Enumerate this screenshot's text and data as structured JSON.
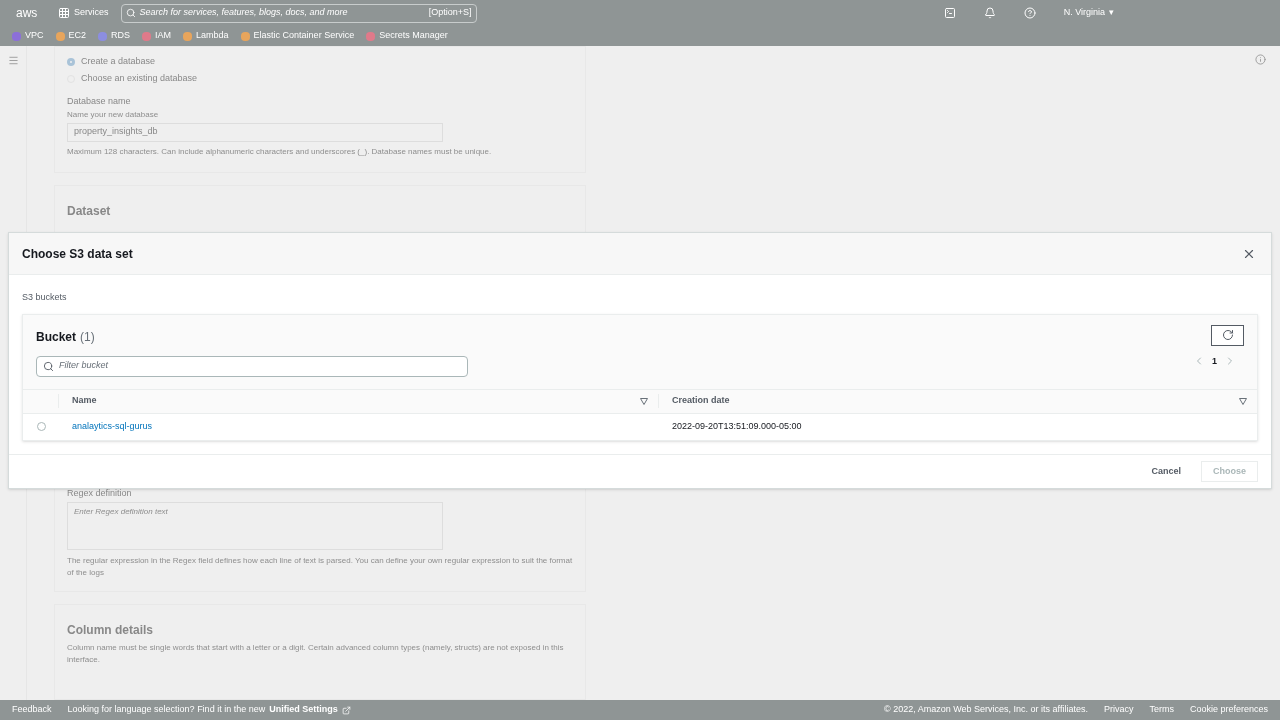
{
  "top_nav": {
    "logo": "aws",
    "services": "Services",
    "region_caret": "▾",
    "search_placeholder": "Search for services, features, blogs, docs, and more",
    "shortcut": "[Option+S]",
    "region": "N. Virginia"
  },
  "favorites": [
    {
      "label": "VPC",
      "color": "#8c6fd8"
    },
    {
      "label": "EC2",
      "color": "#e8a55c"
    },
    {
      "label": "RDS",
      "color": "#8c8ee0"
    },
    {
      "label": "IAM",
      "color": "#e07a8a"
    },
    {
      "label": "Lambda",
      "color": "#e8a55c"
    },
    {
      "label": "Elastic Container Service",
      "color": "#e8a55c"
    },
    {
      "label": "Secrets Manager",
      "color": "#e07a8a"
    }
  ],
  "database": {
    "options": [
      {
        "label": "Create a database",
        "selected": true
      },
      {
        "label": "Choose an existing database",
        "selected": false
      }
    ],
    "name_label": "Database name",
    "name_description": "Name your new database",
    "name_value": "property_insights_db",
    "name_hint": "Maximum 128 characters. Can include alphanumeric characters and underscores (_). Database names must be unique."
  },
  "dataset": {
    "heading": "Dataset",
    "regex_label": "Regex definition",
    "regex_placeholder": "Enter Regex definition text",
    "regex_hint": "The regular expression in the Regex field defines how each line of text is parsed. You can define your own regular expression to suit the format of the logs"
  },
  "column_details": {
    "heading": "Column details",
    "description": "Column name must be single words that start with a letter or a digit. Certain advanced column types (namely, structs) are not exposed in this interface."
  },
  "modal": {
    "title": "Choose S3 data set",
    "section_label": "S3 buckets",
    "table_title": "Bucket",
    "count": "(1)",
    "filter_placeholder": "Filter bucket",
    "page": "1",
    "columns": [
      "Name",
      "Creation date"
    ],
    "rows": [
      {
        "name": "analaytics-sql-gurus",
        "creation_date": "2022-09-20T13:51:09.000-05:00",
        "selected": false
      }
    ],
    "cancel": "Cancel",
    "choose": "Choose",
    "choose_disabled": true
  },
  "footer": {
    "feedback": "Feedback",
    "language_note": "Looking for language selection? Find it in the new",
    "unified_settings": "Unified Settings",
    "copyright": "© 2022, Amazon Web Services, Inc. or its affiliates.",
    "links": [
      "Privacy",
      "Terms",
      "Cookie preferences"
    ]
  }
}
